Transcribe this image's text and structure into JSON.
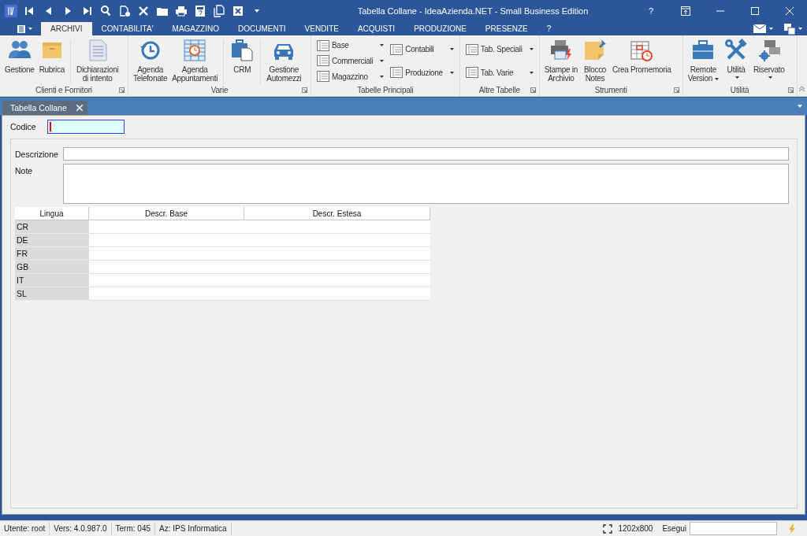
{
  "window": {
    "title": "Tabella Collane - IdeaAzienda.NET - Small Business Edition",
    "help": "?"
  },
  "ribbon_tabs": [
    {
      "label": "ARCHIVI",
      "selected": true
    },
    {
      "label": "CONTABILITA'",
      "selected": false
    },
    {
      "label": "MAGAZZINO",
      "selected": false
    },
    {
      "label": "DOCUMENTI",
      "selected": false
    },
    {
      "label": "VENDITE",
      "selected": false
    },
    {
      "label": "ACQUISTI",
      "selected": false
    },
    {
      "label": "PRODUZIONE",
      "selected": false
    },
    {
      "label": "PRESENZE",
      "selected": false
    },
    {
      "label": "?",
      "selected": false
    }
  ],
  "ribbon_groups": [
    {
      "label": "Clienti e Fornitori",
      "launcher": true,
      "items": [
        {
          "kind": "large",
          "lines": [
            "Gestione"
          ],
          "dropdown": false
        },
        {
          "kind": "large",
          "lines": [
            "Rubrica"
          ],
          "dropdown": false
        },
        {
          "kind": "separator"
        },
        {
          "kind": "large",
          "lines": [
            "Dichiarazioni",
            "di intento"
          ],
          "dropdown": false
        }
      ]
    },
    {
      "label": "Varie",
      "launcher": true,
      "items": [
        {
          "kind": "large",
          "lines": [
            "Agenda",
            "Telefonate"
          ],
          "dropdown": false
        },
        {
          "kind": "large",
          "lines": [
            "Agenda",
            "Appuntamenti"
          ],
          "dropdown": false
        },
        {
          "kind": "separator"
        },
        {
          "kind": "large",
          "lines": [
            "CRM"
          ],
          "dropdown": false
        },
        {
          "kind": "separator"
        },
        {
          "kind": "large",
          "lines": [
            "Gestione",
            "Automezzi"
          ],
          "dropdown": false
        }
      ]
    },
    {
      "label": "Tabelle Principali",
      "launcher": false,
      "items": [
        {
          "kind": "column",
          "items": [
            {
              "label": "Base",
              "dropdown": true
            },
            {
              "label": "Commerciali",
              "dropdown": true
            },
            {
              "label": "Magazzino",
              "dropdown": true
            }
          ]
        },
        {
          "kind": "column",
          "items": [
            {
              "label": "Contabili",
              "dropdown": true
            },
            {
              "label": "Produzione",
              "dropdown": true
            }
          ]
        }
      ]
    },
    {
      "label": "Altre Tabelle",
      "launcher": true,
      "items": [
        {
          "kind": "column",
          "items": [
            {
              "label": "Tab. Speciali",
              "dropdown": true
            },
            {
              "label": "Tab. Varie",
              "dropdown": true
            }
          ]
        }
      ]
    },
    {
      "label": "Strumenti",
      "launcher": true,
      "items": [
        {
          "kind": "large",
          "lines": [
            "Stampe in",
            "Archivio"
          ],
          "dropdown": false
        },
        {
          "kind": "large",
          "lines": [
            "Blocco",
            "Notes"
          ],
          "dropdown": false
        },
        {
          "kind": "large",
          "lines": [
            "Crea Promemoria"
          ],
          "dropdown": false
        }
      ]
    },
    {
      "label": "Utilità",
      "launcher": true,
      "items": [
        {
          "kind": "large",
          "lines": [
            "Remote",
            "Version"
          ],
          "dropdown": true
        },
        {
          "kind": "large",
          "lines": [
            "Utilità"
          ],
          "dropdown": true
        },
        {
          "kind": "large",
          "lines": [
            "Riservato"
          ],
          "dropdown": true
        }
      ]
    }
  ],
  "document_tabs": [
    {
      "label": "Tabella Collane",
      "selected": true
    }
  ],
  "form": {
    "codice": {
      "label": "Codice",
      "focused": true,
      "required": true
    },
    "descrizione": {
      "label": "Descrizione"
    },
    "note": {
      "label": "Note"
    }
  },
  "grid": {
    "columns": [
      "Lingua",
      "Descr. Base",
      "Descr. Estesa"
    ],
    "rows": [
      {
        "lingua": "CR"
      },
      {
        "lingua": "DE"
      },
      {
        "lingua": "FR"
      },
      {
        "lingua": "GB"
      },
      {
        "lingua": "IT"
      },
      {
        "lingua": "SL"
      }
    ]
  },
  "status_bar": {
    "items": [
      "Utente: root",
      "Vers: 4.0.987.0",
      "Term: 045",
      "Az: IPS Informatica"
    ],
    "resolution": "1202x800",
    "run_label": "Esegui"
  }
}
